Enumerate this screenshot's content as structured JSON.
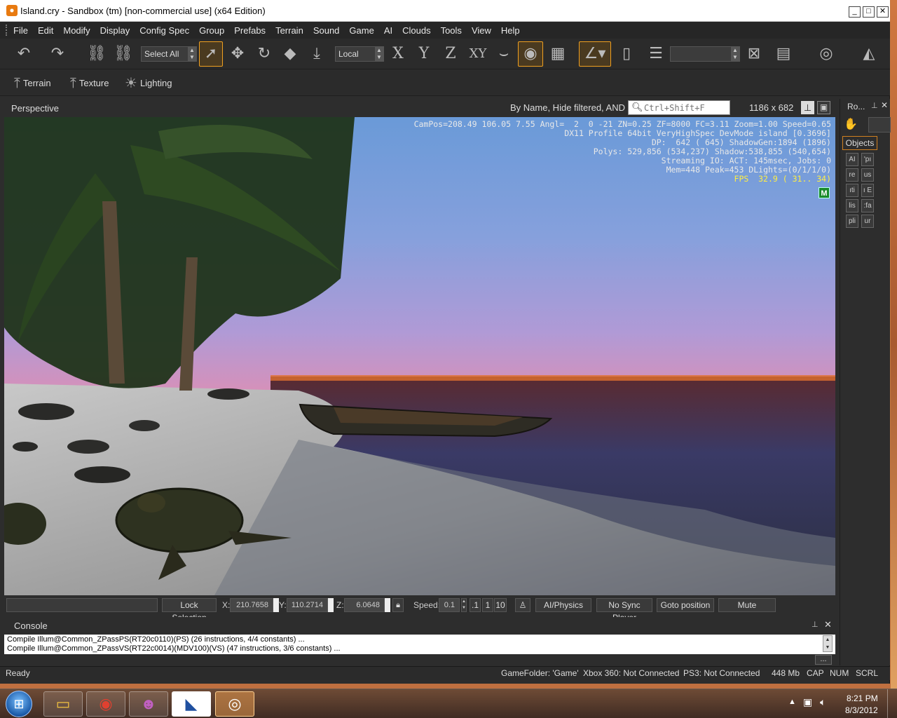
{
  "window": {
    "title": "Island.cry - Sandbox (tm) [non-commercial use] (x64 Edition)",
    "controls": {
      "minimize": "_",
      "maximize": "□",
      "close": "✕"
    }
  },
  "menu": [
    "File",
    "Edit",
    "Modify",
    "Display",
    "Config Spec",
    "Group",
    "Prefabs",
    "Terrain",
    "Sound",
    "Game",
    "AI",
    "Clouds",
    "Tools",
    "View",
    "Help"
  ],
  "toolbar": {
    "select_all": "Select All",
    "coord_space": "Local",
    "axis_x": "X",
    "axis_y": "Y",
    "axis_z": "Z",
    "axis_xy": "XY",
    "search_value": ""
  },
  "toolbar2": {
    "terrain": "Terrain",
    "texture": "Texture",
    "lighting": "Lighting"
  },
  "viewport": {
    "title": "Perspective",
    "filter": "By Name, Hide filtered, AND",
    "search_placeholder": "Ctrl+Shift+F",
    "resolution": "1186 x 682",
    "hud": {
      "line1": "CamPos=208.49 106.05 7.55 Angl=  2  0 -21 ZN=0.25 ZF=8000 FC=3.11 Zoom=1.00 Speed=0.65",
      "line2": "DX11 Profile 64bit VeryHighSpec DevMode island [0.3696]",
      "line3": "DP:  642 ( 645) ShadowGen:1894 (1896)",
      "line4": "Polys: 529,856 (534,237) Shadow:538,855 (540,654)",
      "line5": "Streaming IO: ACT: 145msec, Jobs: 0",
      "line6": "Mem=448 Peak=453 DLights=(0/1/1/0)",
      "fps": "FPS  32.9 ( 31.. 34)",
      "m_badge": "M"
    }
  },
  "statusrow": {
    "lock_selection": "Lock Selection",
    "x_label": "X:",
    "x_value": "210.7658",
    "y_label": "Y:",
    "y_value": "110.2714",
    "z_label": "Z:",
    "z_value": "6.0648",
    "speed_label": "Speed:",
    "speed_value": "0.1",
    "speed_p1": ".1",
    "speed_1": "1",
    "speed_10": "10",
    "ai_physics": "AI/Physics",
    "no_sync": "No Sync Player",
    "goto": "Goto position",
    "mute": "Mute"
  },
  "console": {
    "title": "Console",
    "lines": [
      "Compile Illum@Common_ZPassPS(RT20c0110)(PS) (26 instructions, 4/4 constants) ...",
      "Compile Illum@Common_ZPassVS(RT22c0014)(MDV100)(VS) (47 instructions, 3/6 constants) ..."
    ],
    "more": "..."
  },
  "statusbar": {
    "ready": "Ready",
    "gamefolder": "GameFolder: 'Game'",
    "xbox": "Xbox 360: Not Connected",
    "ps3": "PS3: Not Connected",
    "mem": "448 Mb",
    "cap": "CAP",
    "num": "NUM",
    "scrl": "SCRL"
  },
  "rightpanel": {
    "title": "Ro...",
    "tab": "Objects",
    "buttons": [
      "AI",
      "'pı",
      "re",
      "us",
      "ıti",
      "ı E",
      "lis",
      ":fa",
      "pli",
      "ur"
    ]
  },
  "taskbar": {
    "time": "8:21 PM",
    "date": "8/3/2012"
  }
}
